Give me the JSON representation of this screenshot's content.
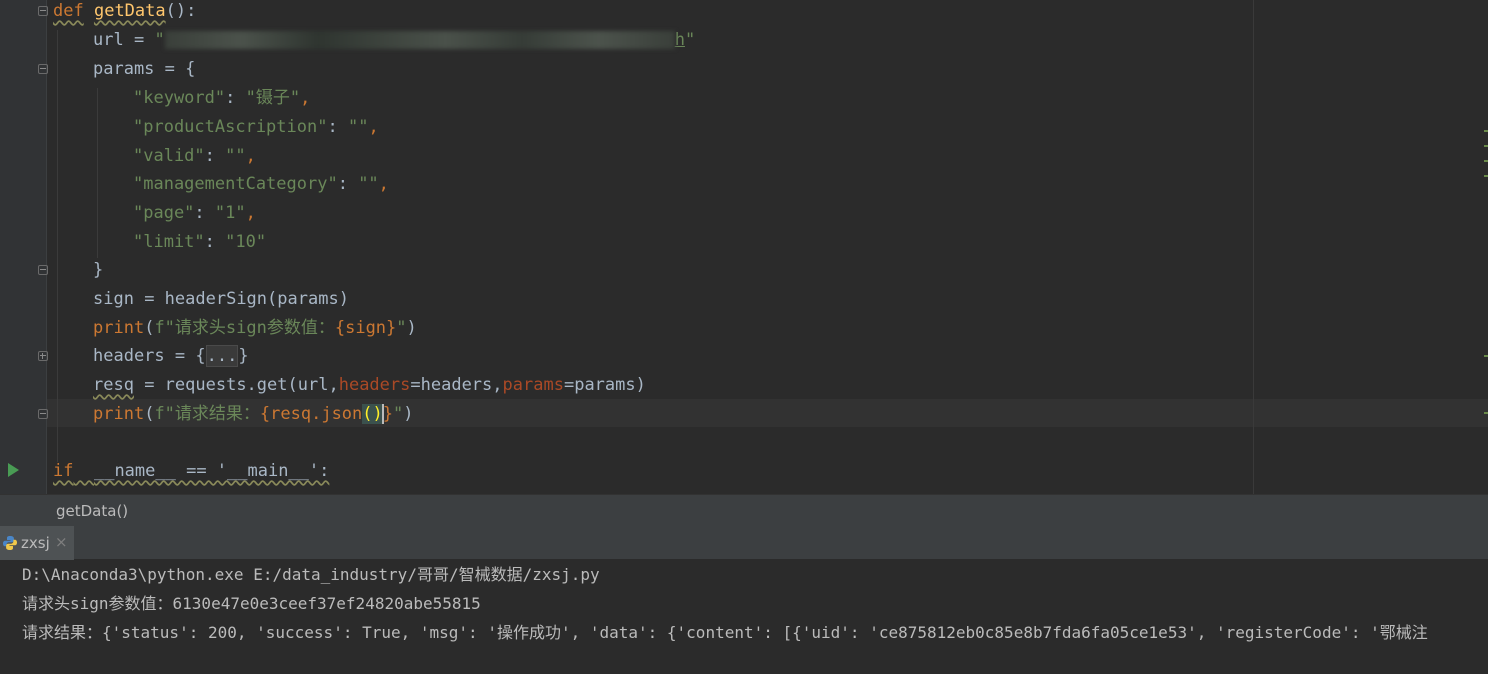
{
  "code": {
    "def_kw": "def",
    "func_name": "getData",
    "url_var": "url",
    "url_open": "\"",
    "url_tail": "h",
    "url_close": "\"",
    "params_var": "params",
    "params_lines": [
      {
        "key": "\"keyword\"",
        "value": "\"镊子\"",
        "comma": ","
      },
      {
        "key": "\"productAscription\"",
        "value": "\"\"",
        "comma": ","
      },
      {
        "key": "\"valid\"",
        "value": "\"\"",
        "comma": ","
      },
      {
        "key": "\"managementCategory\"",
        "value": "\"\"",
        "comma": ","
      },
      {
        "key": "\"page\"",
        "value": "\"1\"",
        "comma": ","
      },
      {
        "key": "\"limit\"",
        "value": "\"10\"",
        "comma": ""
      }
    ],
    "sign_var": "sign",
    "sign_call": "headerSign",
    "sign_arg": "params",
    "print_fn": "print",
    "print1_prefix": "f\"请求头sign参数值：",
    "print1_expr": "{sign}",
    "print1_suffix": "\"",
    "headers_var": "headers",
    "headers_folded": "...",
    "resq_var": "resq",
    "resq_call": "requests.get",
    "resq_arg_url": "url",
    "resq_kw_headers": "headers",
    "resq_val_headers": "headers",
    "resq_kw_params": "params",
    "resq_val_params": "params",
    "print2_prefix": "f\"请求结果：",
    "print2_open": "{resq.json",
    "print2_parens": "()",
    "print2_close": "}",
    "print2_suffix": "\"",
    "main_if": "if",
    "main_cond": "__name__ == '__main__':"
  },
  "breadcrumb": "getData()",
  "run_tab": {
    "label": "zxsj",
    "close": "×"
  },
  "console": [
    "D:\\Anaconda3\\python.exe E:/data_industry/哥哥/智械数据/zxsj.py",
    "请求头sign参数值：6130e47e0e3ceef37ef24820abe55815",
    "请求结果：{'status': 200, 'success': True, 'msg': '操作成功', 'data': {'content': [{'uid': 'ce875812eb0c85e8b7fda6fa05ce1e53', 'registerCode': '鄂械注"
  ],
  "colors": {
    "background": "#2b2b2b",
    "keyword": "#cc7832",
    "function": "#ffc66d",
    "string": "#6a8759",
    "kwarg": "#aa4926",
    "text": "#a9b7c6",
    "run_icon": "#499c54"
  }
}
